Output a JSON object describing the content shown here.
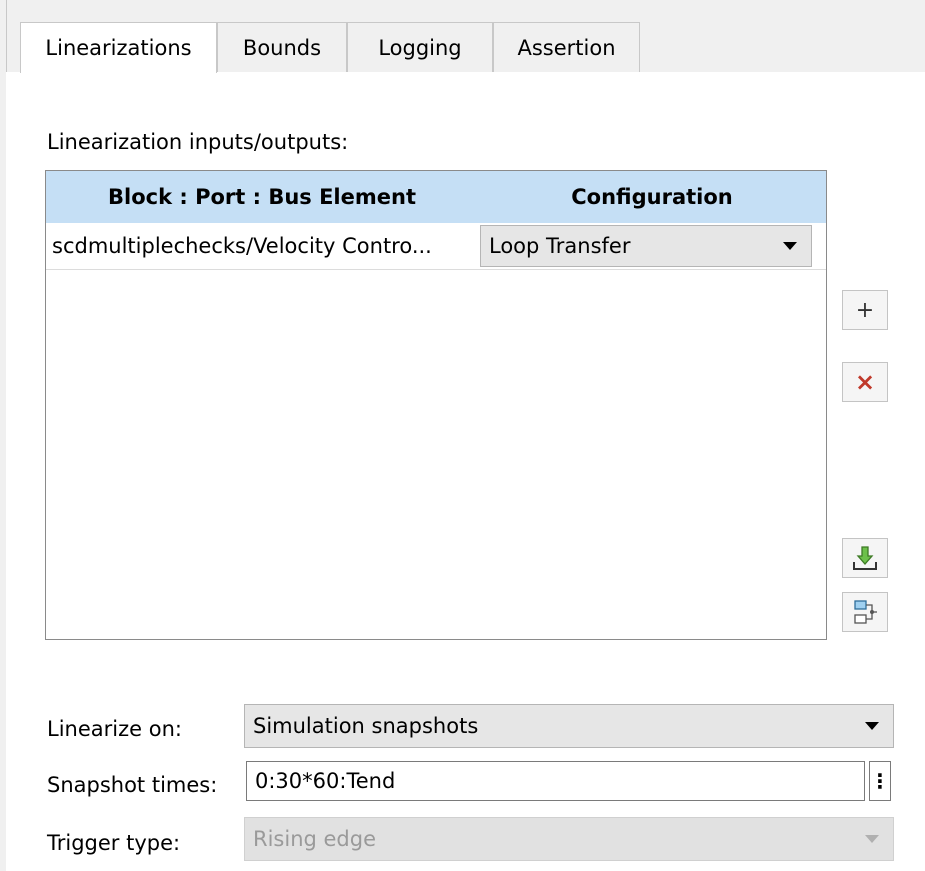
{
  "tabs": [
    {
      "label": "Linearizations",
      "active": true
    },
    {
      "label": "Bounds",
      "active": false
    },
    {
      "label": "Logging",
      "active": false
    },
    {
      "label": "Assertion",
      "active": false
    }
  ],
  "io_section": {
    "label": "Linearization inputs/outputs:",
    "columns": [
      "Block : Port : Bus Element",
      "Configuration"
    ],
    "rows": [
      {
        "block": "scdmultiplechecks/Velocity Contro...",
        "configuration": "Loop Transfer"
      }
    ],
    "buttons": {
      "add": {
        "icon": "plus-icon",
        "glyph": "+"
      },
      "delete": {
        "icon": "close-icon",
        "glyph": "×"
      },
      "import": {
        "icon": "import-icon"
      },
      "highlight": {
        "icon": "model-diagram-icon"
      }
    }
  },
  "linearize_on": {
    "label": "Linearize on:",
    "value": "Simulation snapshots"
  },
  "snapshot_times": {
    "label": "Snapshot times:",
    "value": "0:30*60:Tend",
    "more_glyph": "⋮"
  },
  "trigger_type": {
    "label": "Trigger type:",
    "value": "Rising edge",
    "enabled": false
  },
  "colors": {
    "header_bg": "#c5dff5",
    "delete_red": "#c0392b",
    "import_green": "#5aa83c"
  }
}
